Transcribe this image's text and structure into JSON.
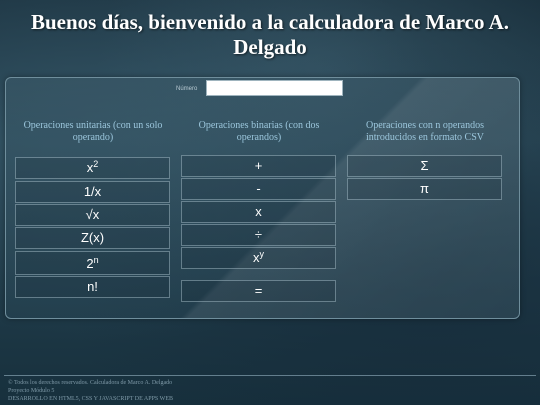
{
  "header": {
    "title": "Buenos días, bienvenido a la calculadora de Marco A. Delgado"
  },
  "input": {
    "label": "Número",
    "value": ""
  },
  "columns": {
    "unary": {
      "heading": "Operaciones unitarias (con un solo operando)",
      "buttons": [
        {
          "base": "x",
          "sup": "2"
        },
        {
          "base": "1/x",
          "sup": ""
        },
        {
          "base": "√x",
          "sup": ""
        },
        {
          "base": "Z(x)",
          "sup": ""
        },
        {
          "base": "2",
          "sup": "n"
        },
        {
          "base": "n!",
          "sup": ""
        }
      ]
    },
    "binary": {
      "heading": "Operaciones binarias (con dos operandos)",
      "buttons": [
        {
          "base": "+",
          "sup": ""
        },
        {
          "base": "-",
          "sup": ""
        },
        {
          "base": "x",
          "sup": ""
        },
        {
          "base": "÷",
          "sup": ""
        },
        {
          "base": "x",
          "sup": "y"
        }
      ],
      "equals": "="
    },
    "nary": {
      "heading": "Operaciones con n operandos introducidos en formato CSV",
      "buttons": [
        {
          "base": "Σ",
          "sup": ""
        },
        {
          "base": "π",
          "sup": ""
        }
      ]
    }
  },
  "footer": {
    "line1": "© Todos los derechos reservados. Calculadora de Marco A. Delgado",
    "line2": "Proyecto Módulo 5",
    "line3": "DESARROLLO EN HTML5, CSS Y JAVASCRIPT DE APPS WEB"
  }
}
